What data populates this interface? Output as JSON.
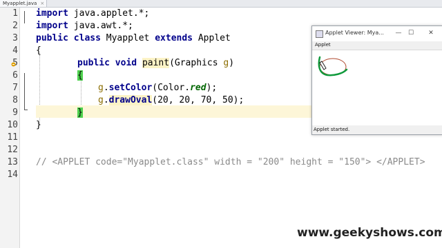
{
  "editor": {
    "tab_title": "Myapplet.java",
    "line_numbers": [
      "1",
      "2",
      "3",
      "4",
      "5",
      "6",
      "7",
      "8",
      "9",
      "10",
      "11",
      "12",
      "13",
      "14"
    ],
    "code": {
      "l1_kw": "import",
      "l1_rest": " java.applet.*;",
      "l2_kw": "import",
      "l2_rest": " java.awt.*;",
      "l3_kw1": "public",
      "l3_kw2": "class",
      "l3_name": " Myapplet ",
      "l3_kw3": "extends",
      "l3_rest": " Applet",
      "l4": "{",
      "l5_kw1": "public",
      "l5_kw2": "void",
      "l5_method": "paint",
      "l5_params": "(Graphics ",
      "l5_g": "g",
      "l5_close": ")",
      "l6": "{",
      "l7_g": "g",
      "l7_dot": ".",
      "l7_method": "setColor",
      "l7_open": "(Color.",
      "l7_red": "red",
      "l7_close": ");",
      "l8_g": "g",
      "l8_dot": ".",
      "l8_method": "drawOval",
      "l8_args": "(20, 20, 70, 50);",
      "l9": "}",
      "l10": "}",
      "l13": "// <APPLET code=\"Myapplet.class\" width = \"200\" height = \"150\"> </APPLET>"
    }
  },
  "applet_window": {
    "title": "Applet Viewer: Mya...",
    "menu": "Applet",
    "status": "Applet started.",
    "minimize": "—",
    "maximize": "☐",
    "close": "✕",
    "oval_color": "#b0492e",
    "annotation_color": "#109a3c"
  },
  "watermark": "www.geekyshows.com"
}
